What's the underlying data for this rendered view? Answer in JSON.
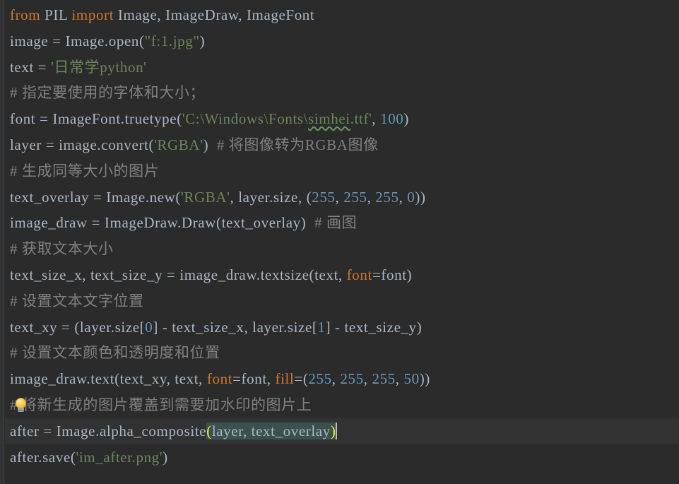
{
  "editor": {
    "app": "code-editor",
    "language": "python",
    "theme": "darcula",
    "colors": {
      "background": "#2b2b2b",
      "current_line": "#323232",
      "gutter": "#313335",
      "default_text": "#a9b7c6",
      "keyword": "#cc7832",
      "string": "#6a8759",
      "number": "#6897bb",
      "comment": "#808080",
      "bracket_match_text": "#ffef28",
      "bracket_match_bg": "#3b514d",
      "squiggle": "#629755",
      "caret": "#bbbbbb"
    },
    "intention_bulb": {
      "icon": "lightbulb-icon",
      "line_index": 15
    },
    "caret": {
      "line_index": 16,
      "after_text": ")"
    }
  },
  "lines": [
    {
      "index": 0,
      "plain": "from PIL import Image, ImageDraw, ImageFont",
      "tokens": [
        {
          "t": "from",
          "c": "kw"
        },
        {
          "t": " PIL ",
          "c": "ident"
        },
        {
          "t": "import",
          "c": "kw"
        },
        {
          "t": " Image, ImageDraw, ImageFont",
          "c": "ident"
        }
      ]
    },
    {
      "index": 1,
      "plain": "image = Image.open(\"f:1.jpg\")",
      "tokens": [
        {
          "t": "image = Image.open(",
          "c": "ident"
        },
        {
          "t": "\"f:1.jpg\"",
          "c": "str"
        },
        {
          "t": ")",
          "c": "ident"
        }
      ]
    },
    {
      "index": 2,
      "plain": "text = '日常学python'",
      "tokens": [
        {
          "t": "text = ",
          "c": "ident"
        },
        {
          "t": "'日常学python'",
          "c": "str"
        }
      ]
    },
    {
      "index": 3,
      "plain": "# 指定要使用的字体和大小；",
      "tokens": [
        {
          "t": "# 指定要使用的字体和大小；",
          "c": "cmt"
        }
      ]
    },
    {
      "index": 4,
      "plain": "font = ImageFont.truetype('C:\\Windows\\Fonts\\simhei.ttf', 100)",
      "tokens": [
        {
          "t": "font = ImageFont.truetype(",
          "c": "ident"
        },
        {
          "t": "'C:\\Windows\\Fonts\\",
          "c": "str"
        },
        {
          "t": "simhei",
          "c": "str squiggly"
        },
        {
          "t": ".ttf'",
          "c": "str"
        },
        {
          "t": ", ",
          "c": "ident"
        },
        {
          "t": "100",
          "c": "num"
        },
        {
          "t": ")",
          "c": "ident"
        }
      ]
    },
    {
      "index": 5,
      "plain": "layer = image.convert('RGBA')  # 将图像转为RGBA图像",
      "tokens": [
        {
          "t": "layer = image.convert(",
          "c": "ident"
        },
        {
          "t": "'RGBA'",
          "c": "str"
        },
        {
          "t": ")",
          "c": "ident"
        },
        {
          "t": "  ",
          "c": "ident"
        },
        {
          "t": "# 将图像转为RGBA图像",
          "c": "cmt"
        }
      ]
    },
    {
      "index": 6,
      "plain": "# 生成同等大小的图片",
      "tokens": [
        {
          "t": "# 生成同等大小的图片",
          "c": "cmt"
        }
      ]
    },
    {
      "index": 7,
      "plain": "text_overlay = Image.new('RGBA', layer.size, (255, 255, 255, 0))",
      "tokens": [
        {
          "t": "text_overlay = Image.new(",
          "c": "ident"
        },
        {
          "t": "'RGBA'",
          "c": "str"
        },
        {
          "t": ", layer.size, (",
          "c": "ident"
        },
        {
          "t": "255",
          "c": "num"
        },
        {
          "t": ", ",
          "c": "ident"
        },
        {
          "t": "255",
          "c": "num"
        },
        {
          "t": ", ",
          "c": "ident"
        },
        {
          "t": "255",
          "c": "num"
        },
        {
          "t": ", ",
          "c": "ident"
        },
        {
          "t": "0",
          "c": "num"
        },
        {
          "t": "))",
          "c": "ident"
        }
      ]
    },
    {
      "index": 8,
      "plain": "image_draw = ImageDraw.Draw(text_overlay)  # 画图",
      "tokens": [
        {
          "t": "image_draw = ImageDraw.Draw(text_overlay)",
          "c": "ident"
        },
        {
          "t": "  ",
          "c": "ident"
        },
        {
          "t": "# 画图",
          "c": "cmt"
        }
      ]
    },
    {
      "index": 9,
      "plain": "# 获取文本大小",
      "tokens": [
        {
          "t": "# 获取文本大小",
          "c": "cmt"
        }
      ]
    },
    {
      "index": 10,
      "plain": "text_size_x, text_size_y = image_draw.textsize(text, font=font)",
      "tokens": [
        {
          "t": "text_size_x, text_size_y = image_draw.textsize(text, ",
          "c": "ident"
        },
        {
          "t": "font",
          "c": "kwarg"
        },
        {
          "t": "=font)",
          "c": "ident"
        }
      ]
    },
    {
      "index": 11,
      "plain": "# 设置文本文字位置",
      "tokens": [
        {
          "t": "# 设置文本文字位置",
          "c": "cmt"
        }
      ]
    },
    {
      "index": 12,
      "plain": "text_xy = (layer.size[0] - text_size_x, layer.size[1] - text_size_y)",
      "tokens": [
        {
          "t": "text_xy = (layer.size[",
          "c": "ident"
        },
        {
          "t": "0",
          "c": "num"
        },
        {
          "t": "] - text_size_x, layer.size[",
          "c": "ident"
        },
        {
          "t": "1",
          "c": "num"
        },
        {
          "t": "] - text_size_y)",
          "c": "ident"
        }
      ]
    },
    {
      "index": 13,
      "plain": "# 设置文本颜色和透明度和位置",
      "tokens": [
        {
          "t": "# 设置文本颜色和透明度和位置",
          "c": "cmt"
        }
      ]
    },
    {
      "index": 14,
      "plain": "image_draw.text(text_xy, text, font=font, fill=(255, 255, 255, 50))",
      "tokens": [
        {
          "t": "image_draw.text(text_xy, text, ",
          "c": "ident"
        },
        {
          "t": "font",
          "c": "kwarg"
        },
        {
          "t": "=font, ",
          "c": "ident"
        },
        {
          "t": "fill",
          "c": "kwarg"
        },
        {
          "t": "=(",
          "c": "ident"
        },
        {
          "t": "255",
          "c": "num"
        },
        {
          "t": ", ",
          "c": "ident"
        },
        {
          "t": "255",
          "c": "num"
        },
        {
          "t": ", ",
          "c": "ident"
        },
        {
          "t": "255",
          "c": "num"
        },
        {
          "t": ", ",
          "c": "ident"
        },
        {
          "t": "50",
          "c": "num"
        },
        {
          "t": "))",
          "c": "ident"
        }
      ]
    },
    {
      "index": 15,
      "plain": "# 将新生成的图片覆盖到需要加水印的图片上",
      "tokens": [
        {
          "t": "# 将新生成的图片覆盖到需要加水印的图片上",
          "c": "cmt"
        }
      ]
    },
    {
      "index": 16,
      "current": true,
      "plain": "after = Image.alpha_composite(layer, text_overlay)",
      "tokens": [
        {
          "t": "after = Image.alpha_composite",
          "c": "ident"
        },
        {
          "t": "(",
          "c": "brk-hl"
        },
        {
          "t": "layer, text_overlay",
          "c": "ident sel-span"
        },
        {
          "t": ")",
          "c": "brk-hl"
        }
      ]
    },
    {
      "index": 17,
      "plain": "after.save('im_after.png')",
      "tokens": [
        {
          "t": "after.save(",
          "c": "ident"
        },
        {
          "t": "'im_after.png'",
          "c": "str"
        },
        {
          "t": ")",
          "c": "ident"
        }
      ]
    }
  ]
}
